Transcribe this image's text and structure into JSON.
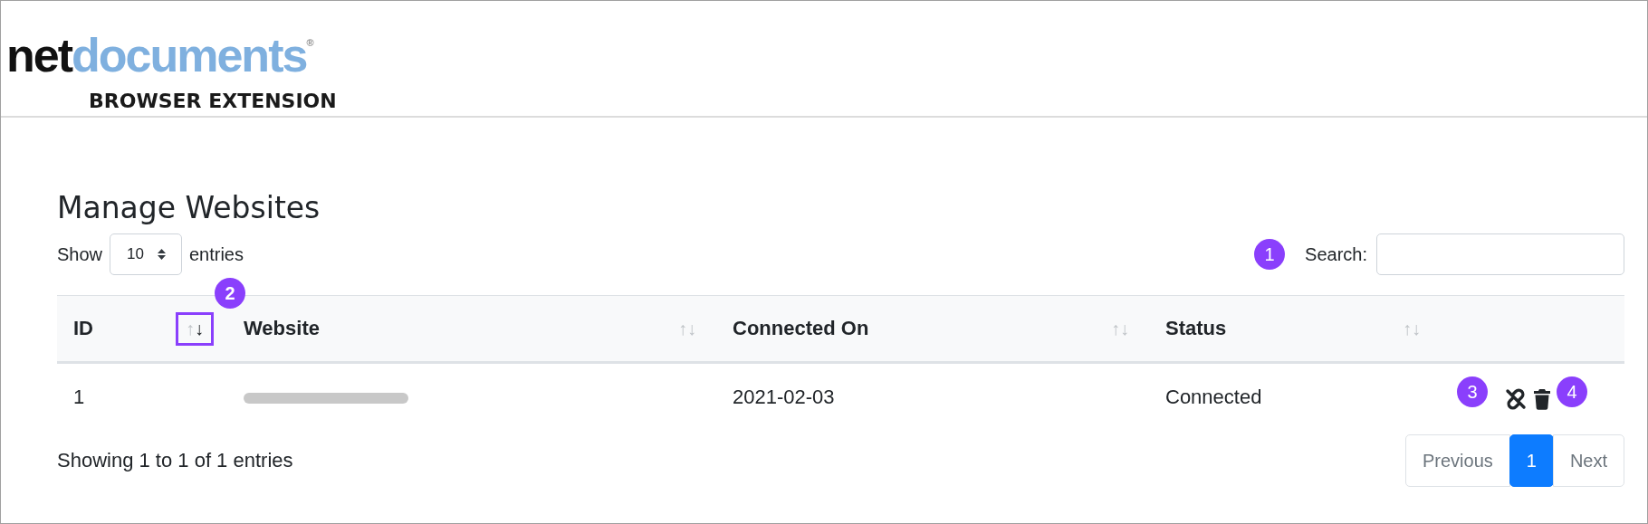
{
  "logo": {
    "dark": "net",
    "light": "documents",
    "mark": "®"
  },
  "subtitle": "BROWSER EXTENSION",
  "title": "Manage Websites",
  "length": {
    "before": "Show",
    "value": "10",
    "after": "entries"
  },
  "search": {
    "label": "Search:",
    "callout": "1"
  },
  "columns": [
    {
      "label": "ID",
      "up": "↑",
      "down": "↓",
      "sorted": true,
      "highlighted": true,
      "callout": "2"
    },
    {
      "label": "Website",
      "up": "↑",
      "down": "↓",
      "sorted": false,
      "highlighted": false
    },
    {
      "label": "Connected On",
      "up": "↑",
      "down": "↓",
      "sorted": false,
      "highlighted": false
    },
    {
      "label": "Status",
      "up": "↑",
      "down": "↓",
      "sorted": false,
      "highlighted": false
    }
  ],
  "rows": [
    {
      "cells": [
        {
          "kind": "text",
          "text": "1"
        },
        {
          "kind": "redacted"
        },
        {
          "kind": "text",
          "text": "2021-02-03"
        },
        {
          "kind": "text",
          "text": "Connected"
        }
      ],
      "actions": [
        {
          "kind": "unlink",
          "callout": "3"
        },
        {
          "kind": "delete",
          "callout": "4"
        }
      ]
    }
  ],
  "info": "Showing 1 to 1 of 1 entries",
  "pages": [
    {
      "label": "Previous",
      "selected": false,
      "disabled": true
    },
    {
      "label": "1",
      "selected": true,
      "disabled": false
    },
    {
      "label": "Next",
      "selected": false,
      "disabled": true
    }
  ]
}
